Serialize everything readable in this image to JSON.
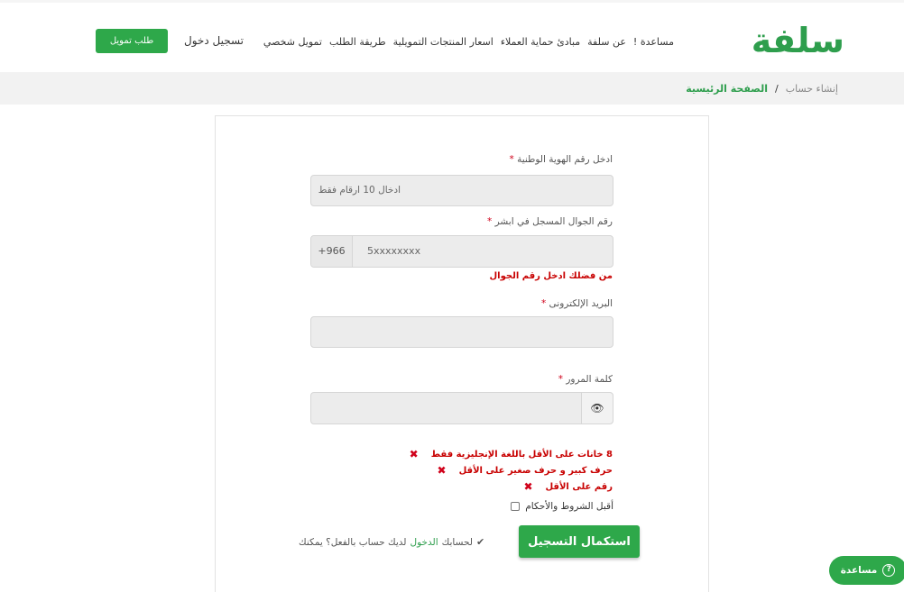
{
  "header": {
    "logo": "سلفة",
    "nav": [
      "تمويل شخصي",
      "طريقة الطلب",
      "اسعار المنتجات التمويلية",
      "مبادئ حماية العملاء",
      "عن سلفة",
      "مساعدة !"
    ],
    "login_label": "تسجيل دخول",
    "finance_button": "طلب تمويل"
  },
  "breadcrumb": {
    "home": "الصفحة الرئيسية",
    "separator": "/",
    "current": "إنشاء حساب"
  },
  "form": {
    "id_label": "ادخل رقم الهوية الوطنية",
    "required_mark": "*",
    "id_placeholder": "ادخال 10 ارقام فقط",
    "phone_label": "رقم الجوال المسجل في ابشر",
    "phone_prefix": "+966",
    "phone_placeholder": "5xxxxxxxx",
    "phone_error": "من فضلك ادخل رقم الجوال",
    "email_label": "البريد الإلكترونى",
    "password_label": "كلمة المرور",
    "password_rules": [
      "8 خانات على الأقل باللغة الإنجليزية فقط",
      "حرف كبير و حرف صغير على الأقل",
      "رقم على الأقل"
    ],
    "terms": "أقبل الشروط والأحكام",
    "submit": "استكمال التسجيل",
    "already_text": "لديك حساب بالفعل؟ يمكنك",
    "already_login": "الدخول",
    "already_suffix": "لحسابك"
  },
  "help": {
    "label": "مساعدة"
  },
  "colors": {
    "brand_green": "#2ea84a",
    "error_red": "#c80000"
  }
}
